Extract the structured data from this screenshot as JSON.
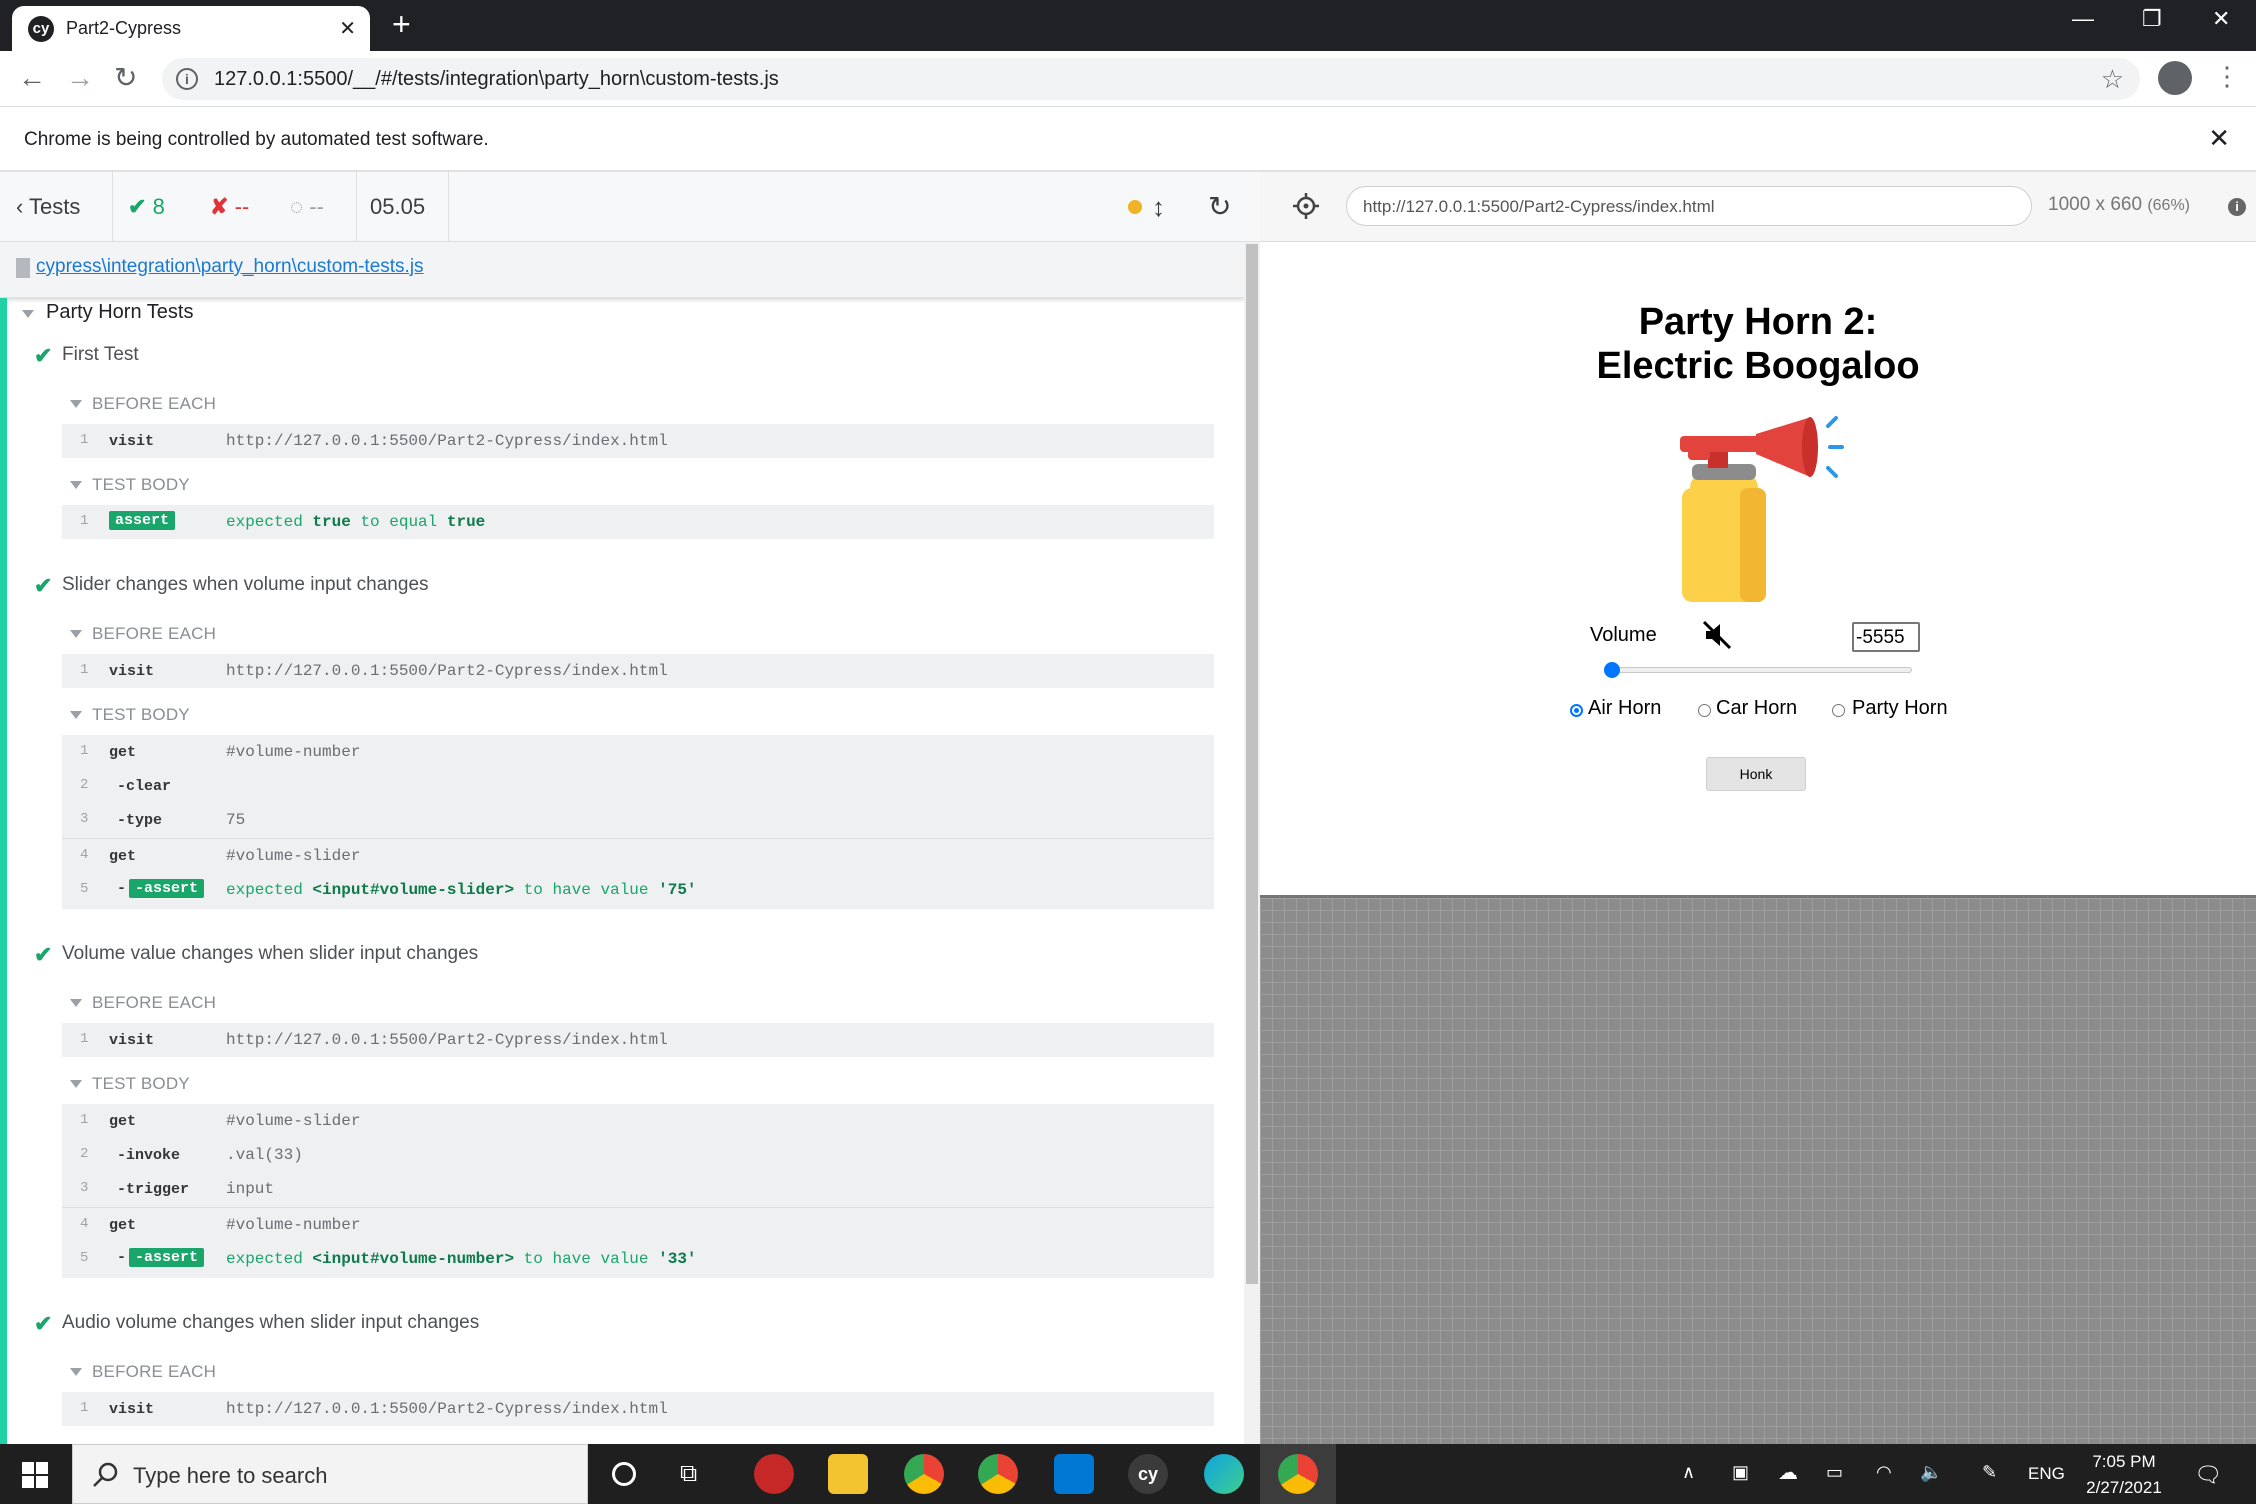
{
  "browser": {
    "tab_title": "Part2-Cypress",
    "tab_favicon": "cy",
    "url": "127.0.0.1:5500/__/#/tests/integration\\party_horn\\custom-tests.js",
    "infobar_message": "Chrome is being controlled by automated test software."
  },
  "reporter": {
    "tests_label": "Tests",
    "passed": "8",
    "failed": "--",
    "pending": "--",
    "duration": "05.05",
    "spec_path": "cypress\\integration\\party_horn\\custom-tests.js",
    "suite": "Party Horn Tests",
    "hooks": {
      "before_each": "BEFORE EACH",
      "test_body": "TEST BODY"
    },
    "tests": [
      {
        "title": "First Test",
        "before_each": [
          {
            "n": "1",
            "name": "visit",
            "msg": "http://127.0.0.1:5500/Part2-Cypress/index.html"
          }
        ],
        "body": [
          {
            "n": "1",
            "name": "assert",
            "expected": "expected",
            "v1": "true",
            "mid": "to equal",
            "v2": "true"
          }
        ]
      },
      {
        "title": "Slider changes when volume input changes",
        "before_each": [
          {
            "n": "1",
            "name": "visit",
            "msg": "http://127.0.0.1:5500/Part2-Cypress/index.html"
          }
        ],
        "body": [
          {
            "n": "1",
            "name": "get",
            "msg": "#volume-number"
          },
          {
            "n": "2",
            "name": "-clear",
            "msg": ""
          },
          {
            "n": "3",
            "name": "-type",
            "msg": "75"
          },
          {
            "n": "4",
            "name": "get",
            "msg": "#volume-slider"
          },
          {
            "n": "5",
            "name": "-assert",
            "expected": "expected",
            "v1": "<input#volume-slider>",
            "mid": "to have value",
            "v2": "'75'"
          }
        ]
      },
      {
        "title": "Volume value changes when slider input changes",
        "before_each": [
          {
            "n": "1",
            "name": "visit",
            "msg": "http://127.0.0.1:5500/Part2-Cypress/index.html"
          }
        ],
        "body": [
          {
            "n": "1",
            "name": "get",
            "msg": "#volume-slider"
          },
          {
            "n": "2",
            "name": "-invoke",
            "msg": ".val(33)"
          },
          {
            "n": "3",
            "name": "-trigger",
            "msg": "input"
          },
          {
            "n": "4",
            "name": "get",
            "msg": "#volume-number"
          },
          {
            "n": "5",
            "name": "-assert",
            "expected": "expected",
            "v1": "<input#volume-number>",
            "mid": "to have value",
            "v2": "'33'"
          }
        ]
      },
      {
        "title": "Audio volume changes when slider input changes",
        "before_each": [
          {
            "n": "1",
            "name": "visit",
            "msg": "http://127.0.0.1:5500/Part2-Cypress/index.html"
          }
        ]
      }
    ]
  },
  "aut": {
    "url": "http://127.0.0.1:5500/Part2-Cypress/index.html",
    "viewport": "1000 x 660",
    "scale": "(66%)",
    "title_line1": "Party Horn 2:",
    "title_line2": "Electric Boogaloo",
    "volume_label": "Volume",
    "volume_value": "-5555",
    "slider_level": 0,
    "radios": [
      "Air Horn",
      "Car Horn",
      "Party Horn"
    ],
    "selected_radio": "Air Horn",
    "honk_label": "Honk"
  },
  "taskbar": {
    "search_placeholder": "Type here to search",
    "language": "ENG",
    "time": "7:05 PM",
    "date": "2/27/2021"
  },
  "colors": {
    "pass": "#1aa56a",
    "fail": "#e0333a",
    "link": "#1b79d3",
    "accent": "#1fd1a4"
  }
}
